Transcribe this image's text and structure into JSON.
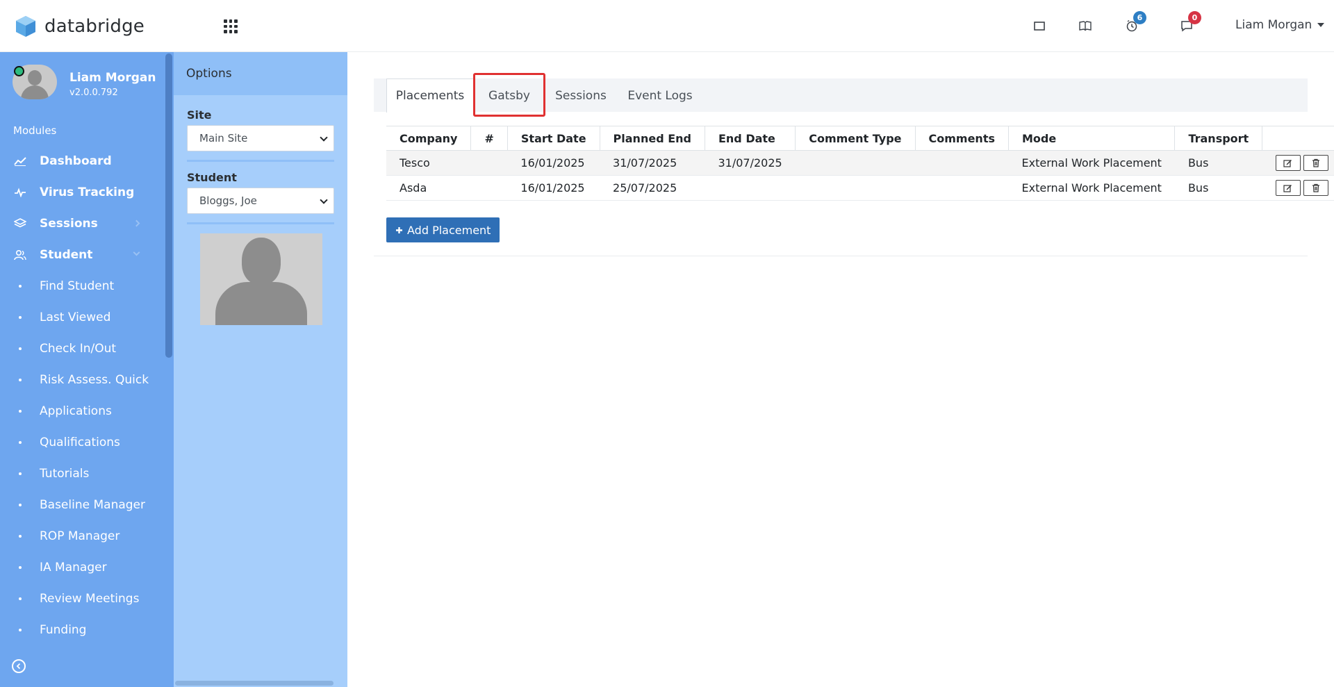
{
  "header": {
    "logo_text": "databridge",
    "user_name": "Liam Morgan",
    "clock_badge": "6",
    "message_badge": "0",
    "badge_colors": {
      "clock": "#2d7ec4",
      "messages": "#d63344"
    }
  },
  "sidebar": {
    "profile_name": "Liam Morgan",
    "profile_version": "v2.0.0.792",
    "modules_label": "Modules",
    "items": [
      {
        "label": "Dashboard",
        "icon": "chart-line-icon"
      },
      {
        "label": "Virus Tracking",
        "icon": "pulse-icon"
      },
      {
        "label": "Sessions",
        "icon": "layers-icon"
      },
      {
        "label": "Student",
        "icon": "users-icon"
      }
    ],
    "sub_items": [
      "Find Student",
      "Last Viewed",
      "Check In/Out",
      "Risk Assess. Quick",
      "Applications",
      "Qualifications",
      "Tutorials",
      "Baseline Manager",
      "ROP Manager",
      "IA Manager",
      "Review Meetings",
      "Funding"
    ],
    "color": "#6ea6ef"
  },
  "options": {
    "title": "Options",
    "site_label": "Site",
    "site_value": "Main Site",
    "student_label": "Student",
    "student_value": "Bloggs, Joe"
  },
  "tabs": [
    {
      "label": "Placements",
      "active": true
    },
    {
      "label": "Gatsby",
      "active": false,
      "highlighted": true
    },
    {
      "label": "Sessions",
      "active": false
    },
    {
      "label": "Event Logs",
      "active": false
    }
  ],
  "table": {
    "columns": [
      "Company",
      "#",
      "Start Date",
      "Planned End",
      "End Date",
      "Comment Type",
      "Comments",
      "Mode",
      "Transport",
      ""
    ],
    "rows": [
      {
        "company": "Tesco",
        "num": "",
        "start": "16/01/2025",
        "planned": "31/07/2025",
        "end": "31/07/2025",
        "comment_type": "",
        "comments": "",
        "mode": "External Work Placement",
        "transport": "Bus"
      },
      {
        "company": "Asda",
        "num": "",
        "start": "16/01/2025",
        "planned": "25/07/2025",
        "end": "",
        "comment_type": "",
        "comments": "",
        "mode": "External Work Placement",
        "transport": "Bus"
      }
    ]
  },
  "add_button_label": "Add Placement",
  "accent_color": "#2f6fb6",
  "highlight_color": "#e03131"
}
